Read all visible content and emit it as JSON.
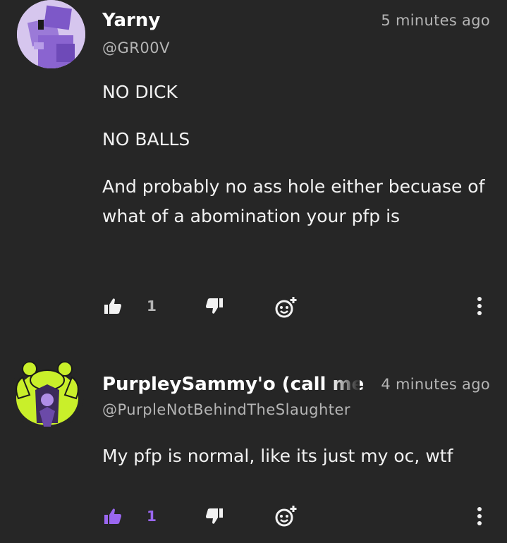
{
  "comments": [
    {
      "username": "Yarny",
      "handle": "@GR00V",
      "time": "5 minutes ago",
      "paragraphs": [
        "NO DICK",
        "NO BALLS",
        "And probably no ass hole either becuase of what of a abomination your pfp is"
      ],
      "likes": "1",
      "liked": false
    },
    {
      "username": "PurpleySammy'o (call me",
      "handle": "@PurpleNotBehindTheSlaughter",
      "time": "4 minutes ago",
      "paragraphs": [
        "My pfp is normal, like its just my oc, wtf"
      ],
      "likes": "1",
      "liked": true
    }
  ],
  "icons": {
    "like": "thumbs-up-icon",
    "dislike": "thumbs-down-icon",
    "react": "add-reaction-icon",
    "more": "more-vertical-icon"
  },
  "colors": {
    "background": "#262626",
    "accent": "#9a67f0",
    "muted": "#b5b5b5",
    "text": "#f2f2f2"
  }
}
